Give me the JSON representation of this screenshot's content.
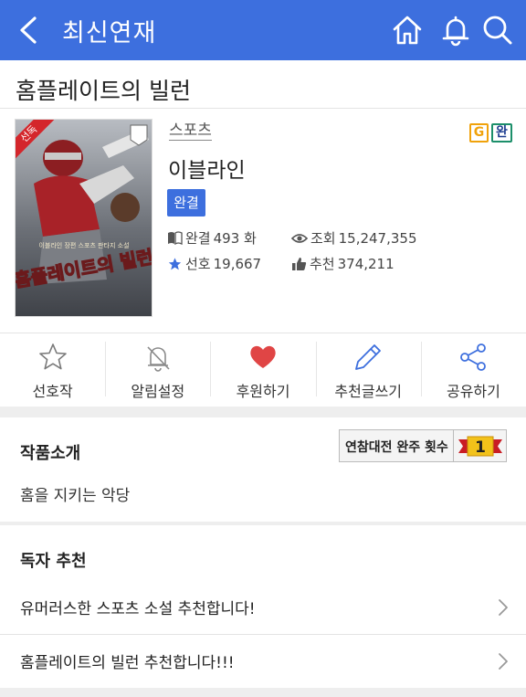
{
  "header": {
    "title": "최신연재",
    "back_icon": "chevron-left-icon",
    "icons": [
      "home-icon",
      "bell-icon",
      "search-icon"
    ]
  },
  "work": {
    "title": "홈플레이트의 빌런",
    "genre": "스포츠",
    "badges": [
      "G",
      "완"
    ],
    "author": "이블라인",
    "status": "완결",
    "cover_badge": "선독",
    "cover_title": "홈플레이트의 빌런",
    "cover_subtitle": "이블라인 장편 스포츠 판타지 소설"
  },
  "stats": {
    "episodes_label": "완결",
    "episodes_value": "493 화",
    "views_label": "조회",
    "views_value": "15,247,355",
    "favorites_label": "선호",
    "favorites_value": "19,667",
    "recommend_label": "추천",
    "recommend_value": "374,211"
  },
  "actions": [
    {
      "label": "선호작",
      "icon": "star-outline-icon"
    },
    {
      "label": "알림설정",
      "icon": "bell-off-icon"
    },
    {
      "label": "후원하기",
      "icon": "heart-icon"
    },
    {
      "label": "추천글쓰기",
      "icon": "pencil-icon"
    },
    {
      "label": "공유하기",
      "icon": "share-icon"
    }
  ],
  "intro": {
    "heading": "작품소개",
    "text": "홈을 지키는 악당",
    "award_label": "연참대전 완주 횟수",
    "award_count": "1"
  },
  "reader_recs": {
    "heading": "독자 추천",
    "items": [
      "유머러스한 스포츠 소설 추천합니다!",
      "홈플레이트의 빌런 추천합니다!!!"
    ]
  },
  "colors": {
    "header_bg": "#3d6fde",
    "status_pill": "#3d6fde",
    "heart": "#e04545",
    "pencil": "#3d6fde",
    "star": "#3d6fde"
  }
}
